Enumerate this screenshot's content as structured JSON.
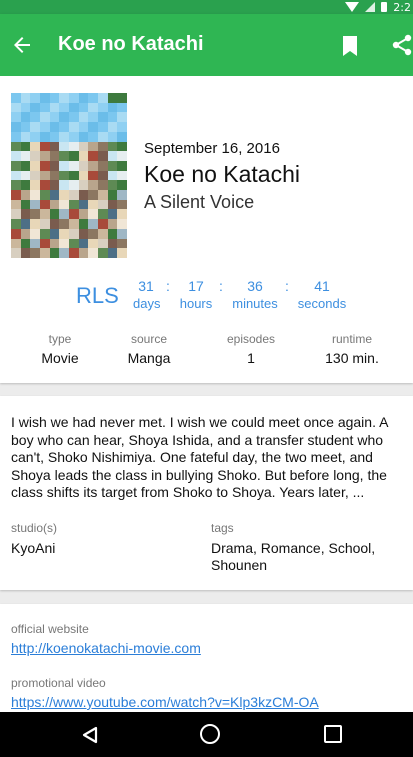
{
  "status_bar": {
    "time": "2:2"
  },
  "app_bar": {
    "title": "Koe no Katachi"
  },
  "header": {
    "date": "September 16, 2016",
    "title": "Koe no Katachi",
    "alt_title": "A Silent Voice"
  },
  "countdown": {
    "label": "RLS",
    "units": [
      {
        "value": "31",
        "label": "days"
      },
      {
        "value": "17",
        "label": "hours"
      },
      {
        "value": "36",
        "label": "minutes"
      },
      {
        "value": "41",
        "label": "seconds"
      }
    ],
    "separator": ":"
  },
  "meta": [
    {
      "key": "type",
      "value": "Movie"
    },
    {
      "key": "source",
      "value": "Manga"
    },
    {
      "key": "episodes",
      "value": "1"
    },
    {
      "key": "runtime",
      "value": "130 min."
    }
  ],
  "synopsis": "I wish we had never met. I wish we could meet once again. A boy who can hear, Shoya Ishida, and a transfer student who can't, Shoko Nishimiya. One fateful day, the two meet, and Shoya leads the class in bullying Shoko. But before long, the class shifts its target from Shoko to Shoya. Years later, ...",
  "studios": {
    "key": "studio(s)",
    "value": "KyoAni"
  },
  "tags": {
    "key": "tags",
    "value": "Drama, Romance, School, Shounen"
  },
  "links": {
    "official_label": "official website",
    "official_url": "http://koenokatachi-movie.com",
    "promo_label": "promotional video",
    "promo_url": "https://www.youtube.com/watch?v=Klp3kzCM-OA"
  },
  "colors": {
    "status_bar": "#2aa14e",
    "app_bar": "#2fb653",
    "accent": "#3d8fe0",
    "link": "#2b7ed8"
  },
  "icons": {
    "back": "arrow-back-icon",
    "bookmark": "bookmark-icon",
    "share": "share-icon"
  }
}
